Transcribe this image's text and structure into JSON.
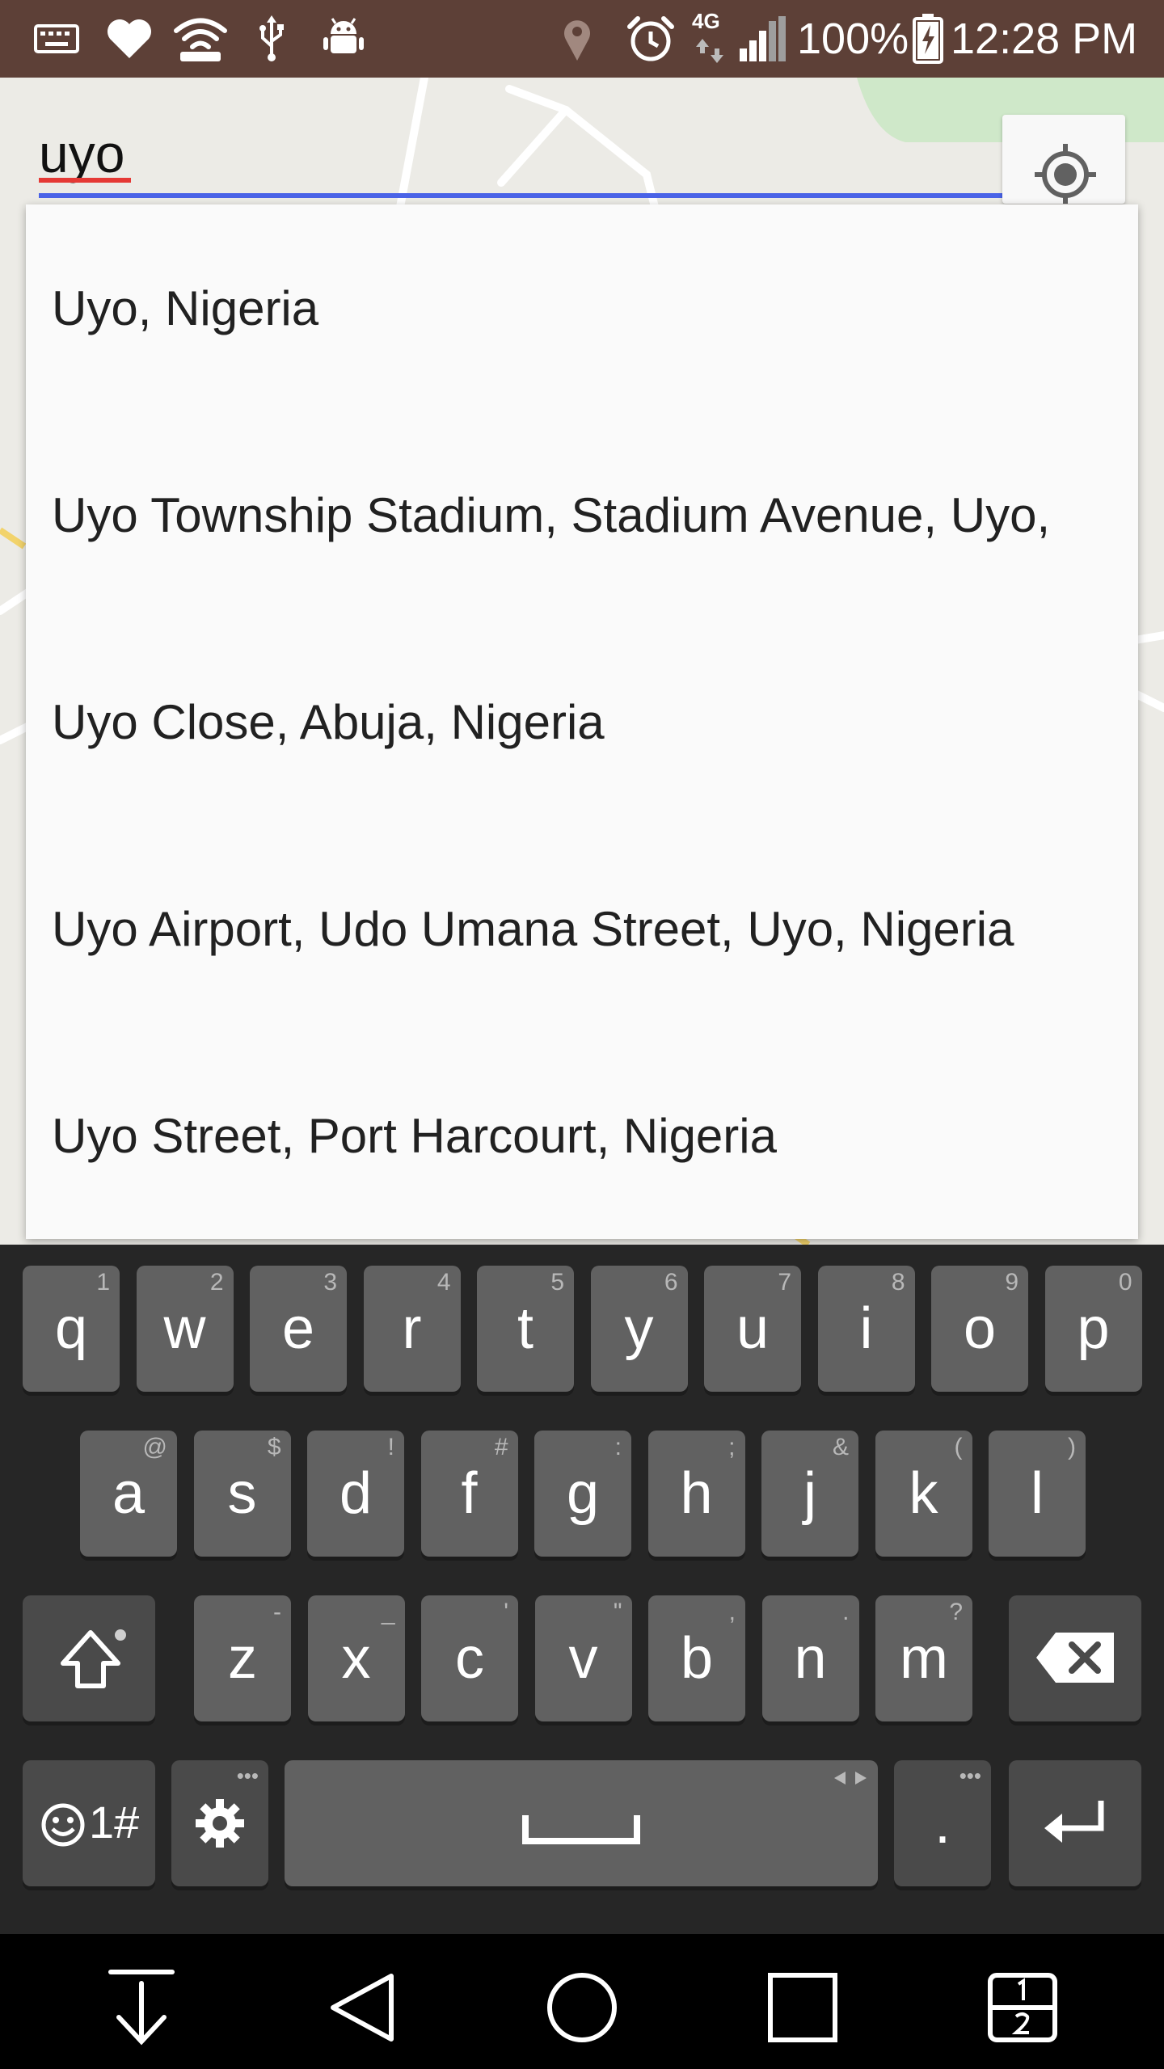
{
  "status_bar": {
    "battery": "100%",
    "time": "12:28 PM",
    "network": "4G",
    "icons": [
      "keyboard-icon",
      "heart-icon",
      "wifi-hotspot-icon",
      "usb-icon",
      "android-debug-icon",
      "location-icon",
      "alarm-icon",
      "signal-icon",
      "battery-charging-icon"
    ]
  },
  "search": {
    "value": "uyo",
    "locate_icon": "my-location-icon"
  },
  "suggestions": [
    "Uyo, Nigeria",
    "Uyo Township Stadium, Stadium Avenue, Uyo,",
    "Uyo Close, Abuja, Nigeria",
    "Uyo Airport, Udo Umana Street, Uyo, Nigeria",
    "Uyo Street, Port Harcourt, Nigeria"
  ],
  "keyboard": {
    "row1": [
      {
        "key": "q",
        "hint": "1"
      },
      {
        "key": "w",
        "hint": "2"
      },
      {
        "key": "e",
        "hint": "3"
      },
      {
        "key": "r",
        "hint": "4"
      },
      {
        "key": "t",
        "hint": "5"
      },
      {
        "key": "y",
        "hint": "6"
      },
      {
        "key": "u",
        "hint": "7"
      },
      {
        "key": "i",
        "hint": "8"
      },
      {
        "key": "o",
        "hint": "9"
      },
      {
        "key": "p",
        "hint": "0"
      }
    ],
    "row2": [
      {
        "key": "a",
        "hint": "@"
      },
      {
        "key": "s",
        "hint": "$"
      },
      {
        "key": "d",
        "hint": "!"
      },
      {
        "key": "f",
        "hint": "#"
      },
      {
        "key": "g",
        "hint": ":"
      },
      {
        "key": "h",
        "hint": ";"
      },
      {
        "key": "j",
        "hint": "&"
      },
      {
        "key": "k",
        "hint": "("
      },
      {
        "key": "l",
        "hint": ")"
      }
    ],
    "row3": [
      {
        "key": "z",
        "hint": "-"
      },
      {
        "key": "x",
        "hint": "_"
      },
      {
        "key": "c",
        "hint": "'"
      },
      {
        "key": "v",
        "hint": "\""
      },
      {
        "key": "b",
        "hint": ","
      },
      {
        "key": "n",
        "hint": "."
      },
      {
        "key": "m",
        "hint": "?"
      }
    ],
    "symbols_label": "1#",
    "period_label": ".",
    "settings_hint": "•••",
    "period_hint": "•••"
  },
  "colors": {
    "status_bar": "#5d4037",
    "accent_line": "#4a63e7",
    "spell_underline": "#e53935",
    "key": "#616161",
    "keyboard_bg": "#262626"
  }
}
